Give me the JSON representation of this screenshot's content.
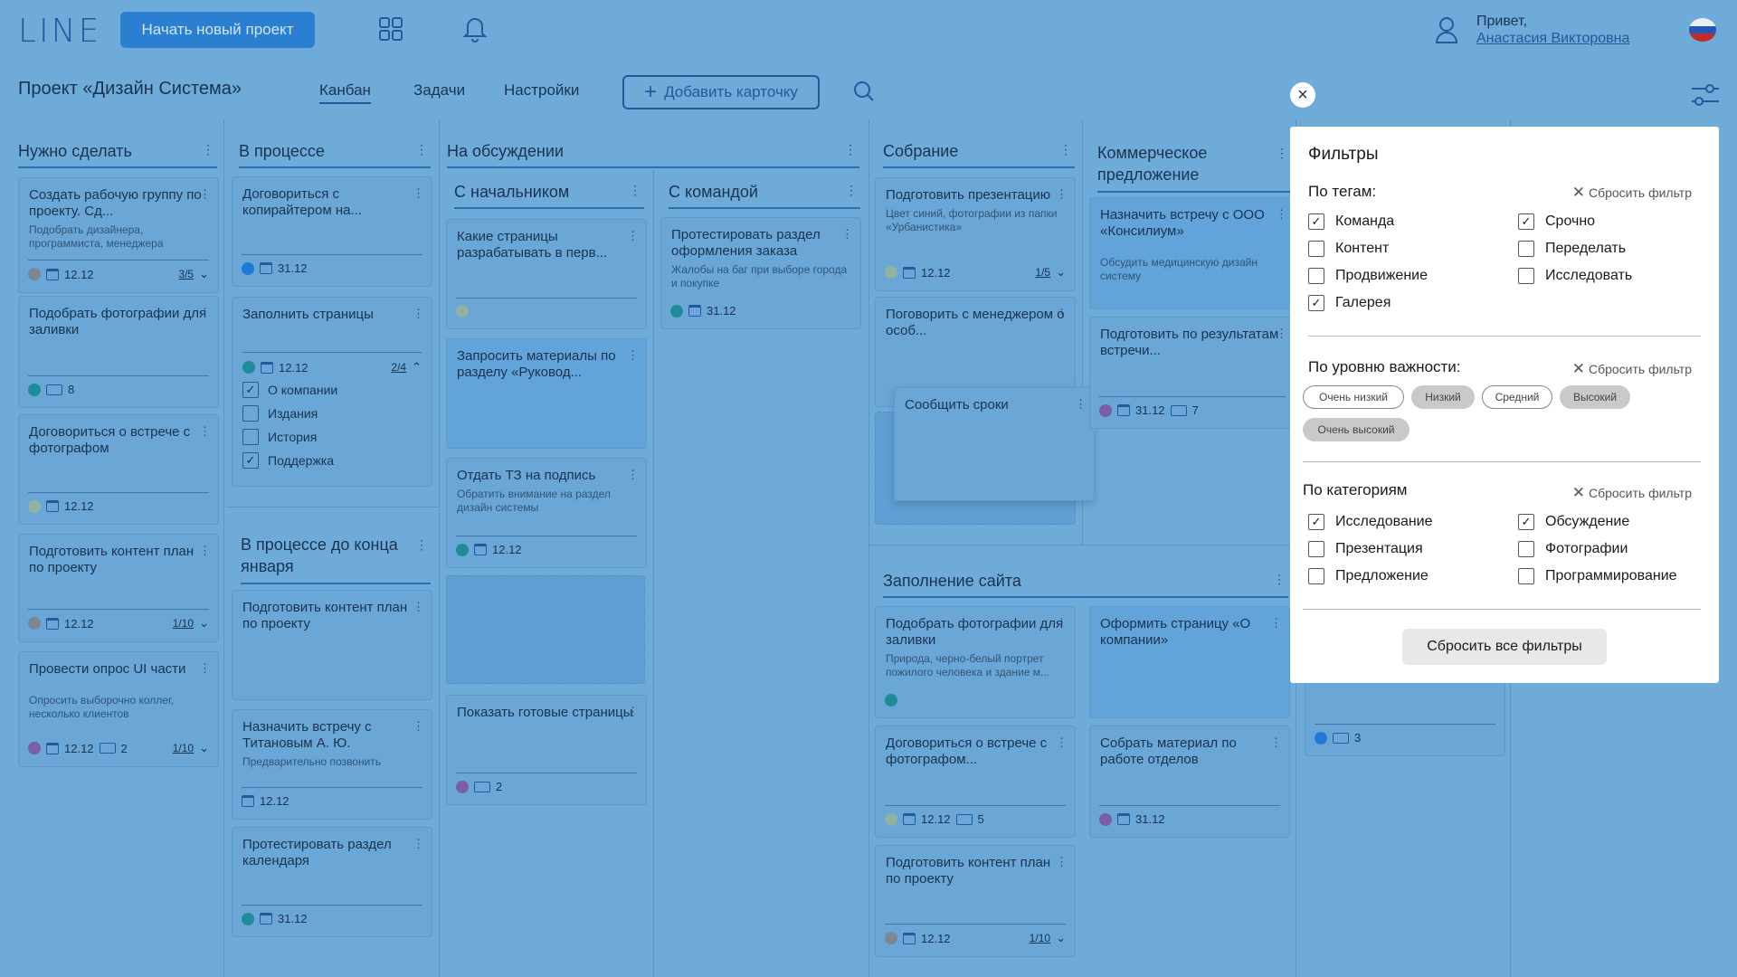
{
  "header": {
    "logo": "LINE",
    "new_project_label": "Начать новый проект",
    "greeting": "Привет,",
    "user_name": "Анастасия Викторовна"
  },
  "subheader": {
    "project_title": "Проект «Дизайн Система»",
    "tabs": [
      "Канбан",
      "Задачи",
      "Настройки"
    ],
    "add_card_label": "Добавить карточку"
  },
  "columns": {
    "todo": {
      "title": "Нужно сделать",
      "cards": [
        {
          "title": "Создать рабочую группу по проекту. Сд...",
          "desc": "Подобрать дизайнера, программиста, менеджера",
          "date": "12.12",
          "count": "3/5"
        },
        {
          "title": "Подобрать фотографии для заливки",
          "tags": "8"
        },
        {
          "title": "Договориться о встрече с фотографом",
          "date": "12.12"
        },
        {
          "title": "Подготовить контент план по проекту",
          "date": "12.12",
          "count": "1/10"
        },
        {
          "title": "Провести опрос UI части",
          "desc": "Опросить выборочно коллег, несколько клиентов",
          "date": "12.12",
          "tags": "2",
          "count": "1/10"
        }
      ]
    },
    "inprogress": {
      "title": "В процессе",
      "cards": [
        {
          "title": "Договориться с копирайтером на...",
          "date": "31.12"
        },
        {
          "title": "Заполнить страницы",
          "date": "12.12",
          "count": "2/4",
          "checklist": [
            {
              "label": "О компании",
              "checked": "✓"
            },
            {
              "label": "Издания",
              "checked": ""
            },
            {
              "label": "История",
              "checked": ""
            },
            {
              "label": "Поддержка",
              "checked": "✓"
            }
          ]
        }
      ]
    },
    "inprogress_jan": {
      "title": "В процессе до конца января",
      "cards": [
        {
          "title": "Подготовить контент план по проекту"
        },
        {
          "title": "Назначить встречу с Титановым А. Ю.",
          "desc": "Предварительно позвонить",
          "date": "12.12"
        },
        {
          "title": "Протестировать раздел календаря",
          "date": "31.12"
        }
      ]
    },
    "discussion": {
      "title": "На обсуждении",
      "boss": {
        "title": "С начальником",
        "cards": [
          {
            "title": "Какие страницы разрабатывать в перв..."
          },
          {
            "title": "Запросить материалы по разделу «Руковод..."
          },
          {
            "title": "Отдать ТЗ на подпись",
            "desc": "Обратить внимание на раздел дизайн системы",
            "date": "12.12"
          },
          {
            "title": "Показать готовые страницы",
            "tags": "2"
          }
        ]
      },
      "team": {
        "title": "С командой",
        "cards": [
          {
            "title": "Протестировать раздел оформления заказа",
            "desc": "Жалобы на баг при выборе города и покупке",
            "date": "31.12"
          }
        ]
      }
    },
    "meeting": {
      "title": "Собрание",
      "cards": [
        {
          "title": "Подготовить презентацию",
          "desc": "Цвет синий, фотографии из папки «Урбанистика»",
          "date": "12.12",
          "count": "1/5"
        },
        {
          "title": "Поговорить с менеджером о особ..."
        }
      ],
      "drag_card": "Сообщить сроки"
    },
    "commercial": {
      "title": "Коммерческое предложение",
      "cards": [
        {
          "title": "Назначить встречу с ООО «Консилиум»",
          "desc": "Обсудить медицинскую дизайн систему"
        },
        {
          "title": "Подготовить по результатам встречи...",
          "date": "31.12",
          "tags": "7"
        }
      ]
    },
    "site": {
      "title": "Заполнение сайта",
      "cards_left": [
        {
          "title": "Подобрать фотографии для заливки",
          "desc": "Природа, черно-белый портрет пожилого человека и здание м..."
        },
        {
          "title": "Договориться о встрече с фотографом...",
          "date": "12.12",
          "tags": "5"
        },
        {
          "title": "Подготовить контент план по проекту",
          "date": "12.12",
          "count": "1/10"
        }
      ],
      "cards_right": [
        {
          "title": "Оформить страницу «О компании»"
        },
        {
          "title": "Собрать материал по работе отделов",
          "date": "31.12"
        }
      ],
      "extra_tags": "3"
    }
  },
  "filters": {
    "title": "Фильтры",
    "reset_label": "Сбросить фильтр",
    "tags_title": "По тегам:",
    "tags": [
      {
        "label": "Команда",
        "checked": "✓"
      },
      {
        "label": "Срочно",
        "checked": "✓"
      },
      {
        "label": "Контент",
        "checked": ""
      },
      {
        "label": "Переделать",
        "checked": ""
      },
      {
        "label": "Продвижение",
        "checked": ""
      },
      {
        "label": "Исследовать",
        "checked": ""
      },
      {
        "label": "Галерея",
        "checked": "✓"
      }
    ],
    "importance_title": "По уровню важности:",
    "importance": [
      "Очень низкий",
      "Низкий",
      "Средний",
      "Высокий",
      "Очень высокий"
    ],
    "categories_title": "По категориям",
    "categories": [
      {
        "label": "Исследование",
        "checked": "✓"
      },
      {
        "label": "Обсуждение",
        "checked": "✓"
      },
      {
        "label": "Презентация",
        "checked": ""
      },
      {
        "label": "Фотографии",
        "checked": ""
      },
      {
        "label": "Предложение",
        "checked": ""
      },
      {
        "label": "Программирование",
        "checked": ""
      }
    ],
    "reset_all_label": "Сбросить все фильтры"
  },
  "colors": {
    "overlay_bg": "#6fabd9",
    "accent": "#2b7fd1",
    "dot_gray": "#7b8894",
    "dot_teal": "#1f8c9a",
    "dot_blue": "#1e7ad6",
    "dot_purple": "#7a5ea8",
    "dot_sage": "#8fb3a0"
  }
}
